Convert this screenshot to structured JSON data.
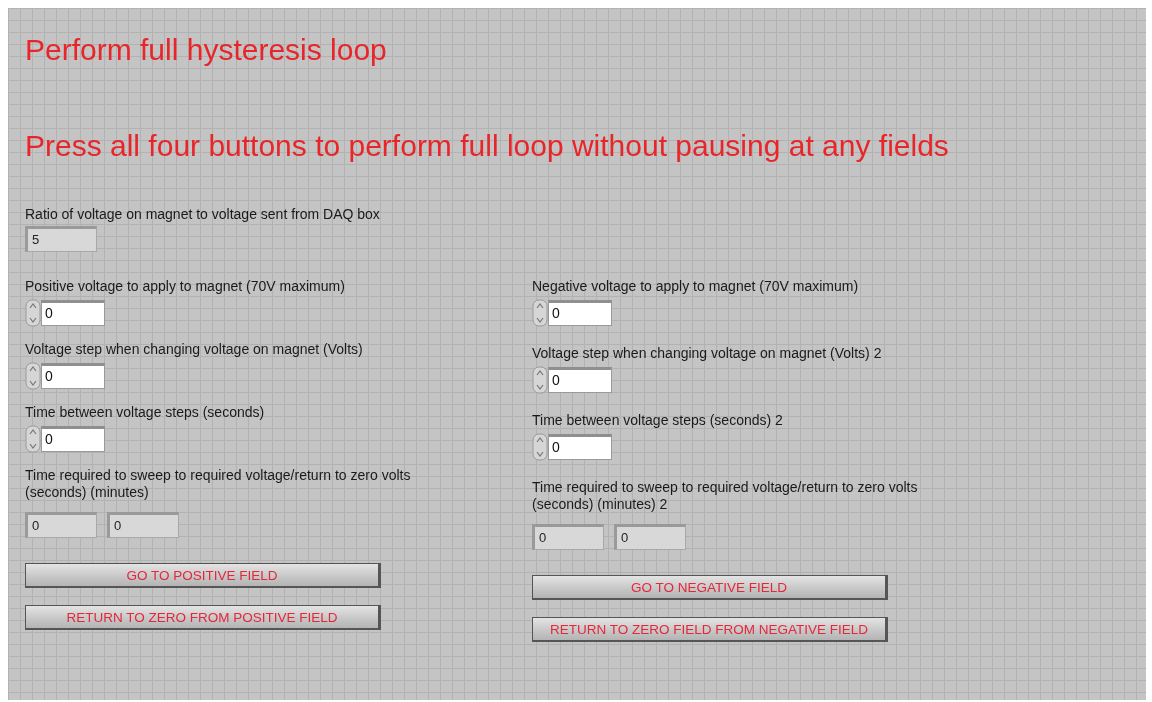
{
  "title": "Perform full hysteresis loop",
  "instruction": "Press all four buttons to perform full loop without pausing at any fields",
  "ratio": {
    "label": "Ratio of voltage on magnet to voltage sent from DAQ box",
    "value": "5"
  },
  "columns": [
    {
      "numeric_controls": [
        {
          "label": "Positive voltage to apply to magnet (70V maximum)",
          "value": "0"
        },
        {
          "label": "Voltage step when changing voltage on magnet (Volts)",
          "value": "0"
        },
        {
          "label": "Time between voltage steps (seconds)",
          "value": "0"
        }
      ],
      "sweep_time": {
        "label": "Time required to sweep to required voltage/return to zero volts\n(seconds)   (minutes)",
        "seconds": "0",
        "minutes": "0"
      },
      "buttons": [
        "GO TO POSITIVE FIELD",
        "RETURN TO ZERO FROM POSITIVE FIELD"
      ]
    },
    {
      "numeric_controls": [
        {
          "label": "Negative voltage to apply to magnet (70V maximum)",
          "value": "0"
        },
        {
          "label": "Voltage step when changing voltage on magnet (Volts) 2",
          "value": "0"
        },
        {
          "label": "Time between voltage steps (seconds) 2",
          "value": "0"
        }
      ],
      "sweep_time": {
        "label": "Time required to sweep to required voltage/return to zero volts\n(seconds)    (minutes) 2",
        "seconds": "0",
        "minutes": "0"
      },
      "buttons": [
        "GO TO NEGATIVE FIELD",
        "RETURN TO ZERO FIELD FROM NEGATIVE FIELD"
      ]
    }
  ]
}
